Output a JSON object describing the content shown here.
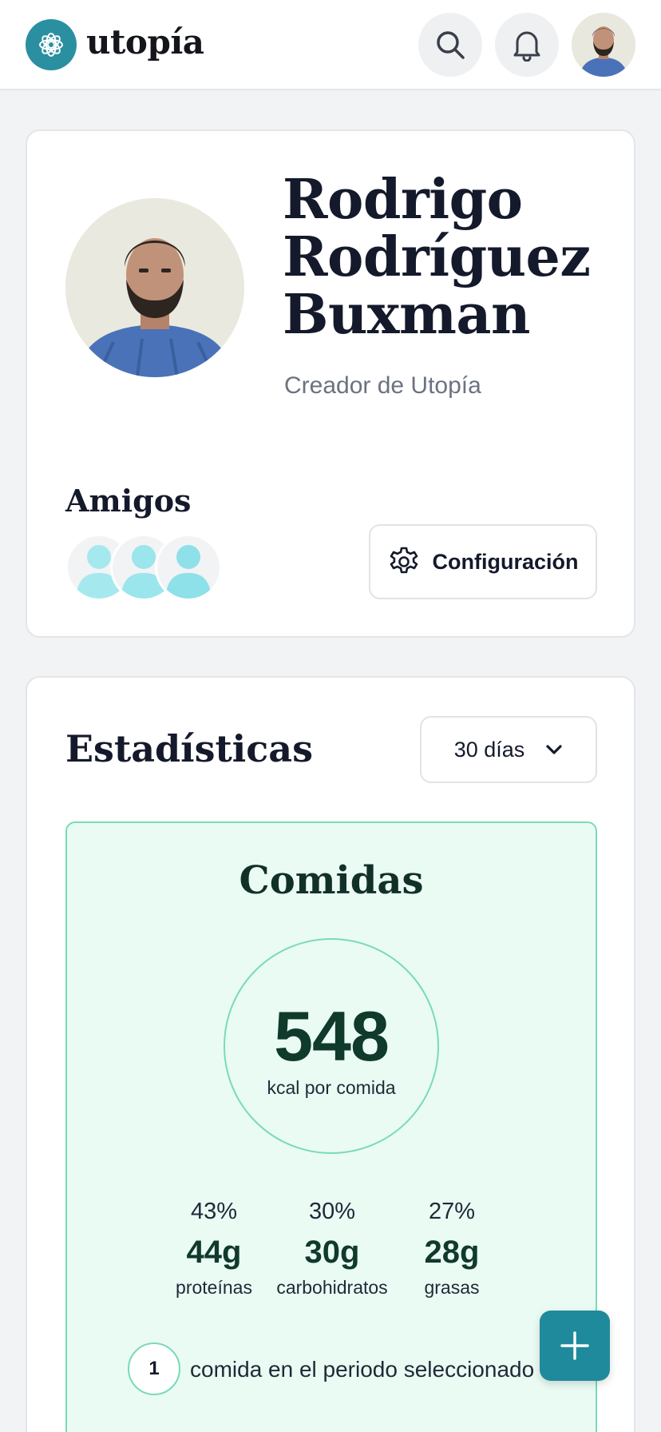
{
  "header": {
    "logo_text": "utopía",
    "search_label": "search",
    "notifications_label": "notifications"
  },
  "profile": {
    "first_name": "Rodrigo",
    "last_name_1": "Rodríguez",
    "last_name_2": "Buxman",
    "subtitle": "Creador de Utopía",
    "friends_title": "Amigos",
    "friends_count": 3,
    "config_label": "Configuración"
  },
  "stats": {
    "title": "Estadísticas",
    "range_selected": "30 días",
    "meals": {
      "title": "Comidas",
      "kcal_value": "548",
      "kcal_label": "kcal por comida",
      "macros": [
        {
          "pct": "43%",
          "grams": "44g",
          "name": "proteínas"
        },
        {
          "pct": "30%",
          "grams": "30g",
          "name": "carbohidratos"
        },
        {
          "pct": "27%",
          "grams": "28g",
          "name": "grasas"
        }
      ],
      "count": "1",
      "count_text": "comida en el periodo seleccionado"
    }
  },
  "colors": {
    "brand": "#2a8fa0",
    "panel_bg": "#eafbf3",
    "panel_border": "#79dbb7",
    "fab": "#1f8a9b"
  },
  "icons": {
    "logo": "flower-logo-icon",
    "search": "search-icon",
    "bell": "bell-icon",
    "gear": "gear-icon",
    "chevron": "chevron-down-icon",
    "plus": "plus-icon"
  }
}
